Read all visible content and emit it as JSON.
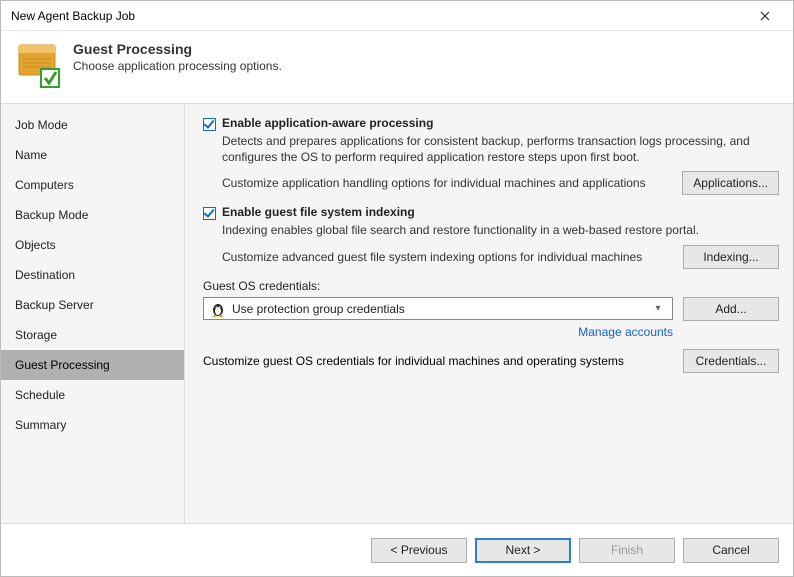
{
  "window": {
    "title": "New Agent Backup Job"
  },
  "header": {
    "title": "Guest Processing",
    "subtitle": "Choose application processing options."
  },
  "sidebar": {
    "items": [
      {
        "label": "Job Mode"
      },
      {
        "label": "Name"
      },
      {
        "label": "Computers"
      },
      {
        "label": "Backup Mode"
      },
      {
        "label": "Objects"
      },
      {
        "label": "Destination"
      },
      {
        "label": "Backup Server"
      },
      {
        "label": "Storage"
      },
      {
        "label": "Guest Processing"
      },
      {
        "label": "Schedule"
      },
      {
        "label": "Summary"
      }
    ],
    "active_index": 8
  },
  "content": {
    "app_aware": {
      "label": "Enable application-aware processing",
      "desc": "Detects and prepares applications for consistent backup, performs transaction logs processing, and configures the OS to perform required application restore steps upon first boot.",
      "customize_text": "Customize application handling options for individual machines and applications",
      "button": "Applications..."
    },
    "indexing": {
      "label": "Enable guest file system indexing",
      "desc": "Indexing enables global file search and restore functionality in a web-based restore portal.",
      "customize_text": "Customize advanced guest file system indexing options for individual machines",
      "button": "Indexing..."
    },
    "credentials": {
      "label": "Guest OS credentials:",
      "selected": "Use protection group credentials",
      "add_button": "Add...",
      "manage_link": "Manage accounts",
      "customize_text": "Customize guest OS credentials for individual machines and operating systems",
      "button": "Credentials..."
    }
  },
  "footer": {
    "previous": "< Previous",
    "next": "Next >",
    "finish": "Finish",
    "cancel": "Cancel"
  }
}
